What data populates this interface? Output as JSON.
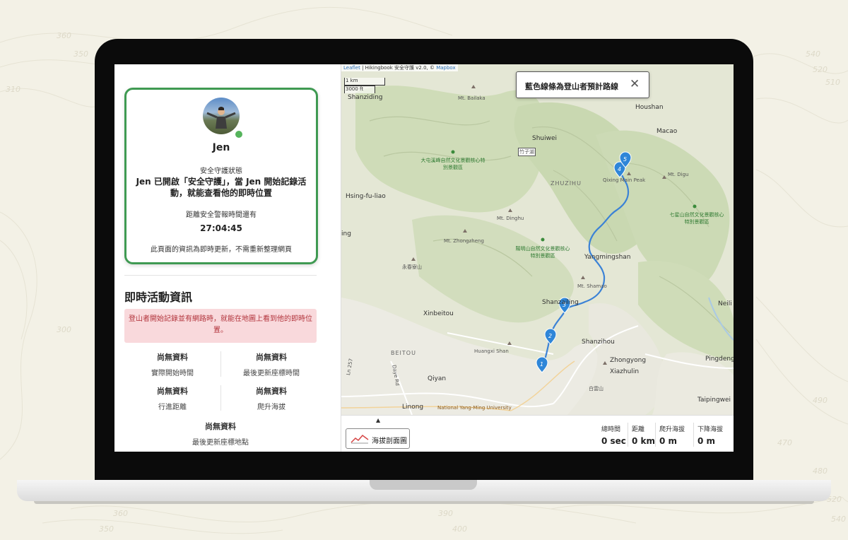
{
  "sidebar": {
    "card": {
      "name": "Jen",
      "status_title": "安全守護狀態",
      "message": "Jen 已開啟「安全守護」，當 Jen 開始記錄活動，就能查看他的即時位置",
      "countdown_label": "距離安全警報時間還有",
      "countdown": "27:04:45",
      "note": "此頁面的資訊為即時更新，不需重新整理網頁"
    },
    "live_heading": "即時活動資訊",
    "alert": "登山者開始記錄並有網路時，就能在地圖上看到他的即時位置。",
    "stats": [
      {
        "value": "尚無資料",
        "label": "實際開始時間"
      },
      {
        "value": "尚無資料",
        "label": "最後更新座標時間"
      },
      {
        "value": "尚無資料",
        "label": "行進距離"
      },
      {
        "value": "尚無資料",
        "label": "爬升海拔"
      },
      {
        "value": "尚無資料",
        "label": "最後更新座標地點"
      }
    ]
  },
  "map": {
    "attribution": {
      "leaflet": "Leaflet",
      "middle": " | Hikingbook 安全守護 v2.0, © ",
      "mapbox": "Mapbox"
    },
    "scale": {
      "metric": "1 km",
      "imperial": "3000 ft"
    },
    "tooltip": {
      "text": "藍色線條為登山者預計路線",
      "close": "✕"
    },
    "labels": {
      "shanziding": "Shanziding",
      "bailaka": "Mt. Bailaka",
      "houshan": "Houshan",
      "macao": "Macao",
      "shuiwei": "Shuiwei",
      "zhuzihu": "ZHUZIHU",
      "qixing": "Qixing Main Peak",
      "digu": "Mt. Digu",
      "datun_reserve": "大屯溪峰自然文化景觀核心特別景觀區",
      "qixingshan_reserve": "七星山自然文化景觀核心特別景觀區",
      "hsing": "Hsing-fu-liao",
      "ing": "ing",
      "dinghu": "Mt. Dinghu",
      "zhongzheng": "Mt. Zhongzheng",
      "yangmingshan_reserve": "陽明山自然文化景觀核心特別景觀區",
      "yongchun": "永春寮山",
      "yangmingshan": "Yangmingshan",
      "shamao": "Mt. Shamao",
      "shanzailing": "Shanzailing",
      "xinbeitou": "Xinbeitou",
      "neili": "Neili",
      "huangxi": "Huangxi Shan",
      "shanzihou": "Shanzihou",
      "beitou": "BEITOU",
      "zhongyong": "Zhongyong",
      "xiazhulin": "Xiazhulin",
      "pingdengli": "Pingdengli",
      "baiyun": "白雲山",
      "dayerd": "Daye Rd",
      "qiyan": "Qiyan",
      "ln257": "Ln 257",
      "linong": "Linong",
      "nymu": "National Yang-Ming University",
      "taipingwei": "Taipingwei",
      "bridge": "竹子湖"
    },
    "markers": [
      "1",
      "2",
      "3",
      "4",
      "5"
    ],
    "colors": {
      "route": "#3b82d6",
      "marker": "#2f86d8",
      "card_border": "#3f9a52"
    }
  },
  "bottom_bar": {
    "toggle_icon": "▲",
    "profile_button": "海拔剖面圖",
    "summary": [
      {
        "label": "總時間",
        "value": "0 sec"
      },
      {
        "label": "距離",
        "value": "0 km"
      },
      {
        "label": "爬升海拔",
        "value": "0 m"
      },
      {
        "label": "下降海拔",
        "value": "0 m"
      }
    ]
  },
  "background_numbers": [
    "360",
    "350",
    "310",
    "540",
    "520",
    "510",
    "300",
    "490",
    "470",
    "360",
    "350",
    "390",
    "400",
    "480",
    "520",
    "540"
  ]
}
